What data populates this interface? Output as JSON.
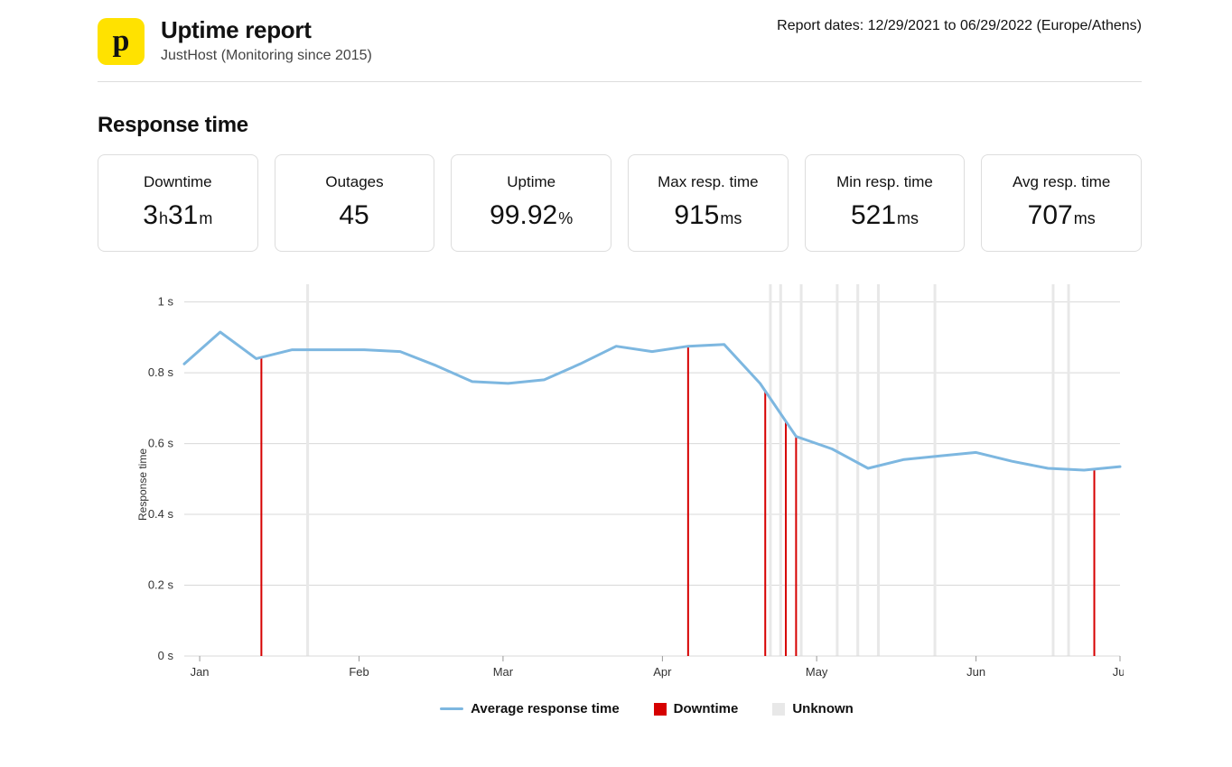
{
  "header": {
    "logo_char": "p",
    "title": "Uptime report",
    "subtitle": "JustHost (Monitoring since 2015)",
    "report_dates": "Report dates: 12/29/2021 to 06/29/2022 (Europe/Athens)"
  },
  "section_title": "Response time",
  "stats": {
    "downtime": {
      "label": "Downtime",
      "value_h": "3",
      "value_m": "31",
      "unit_h": "h",
      "unit_m": "m"
    },
    "outages": {
      "label": "Outages",
      "value": "45",
      "unit": ""
    },
    "uptime": {
      "label": "Uptime",
      "value": "99.92",
      "unit": "%"
    },
    "max": {
      "label": "Max resp. time",
      "value": "915",
      "unit": "ms"
    },
    "min": {
      "label": "Min resp. time",
      "value": "521",
      "unit": "ms"
    },
    "avg": {
      "label": "Avg resp. time",
      "value": "707",
      "unit": "ms"
    }
  },
  "legend": {
    "avg": "Average response time",
    "downtime": "Downtime",
    "unknown": "Unknown"
  },
  "chart_data": {
    "type": "line",
    "title": "",
    "xlabel": "",
    "ylabel": "Response time",
    "ylim": [
      0,
      1.05
    ],
    "y_ticks": [
      0,
      0.2,
      0.4,
      0.6,
      0.8,
      1.0
    ],
    "y_tick_labels": [
      "0 s",
      "0.2 s",
      "0.4 s",
      "0.6 s",
      "0.8 s",
      "1 s"
    ],
    "x_range_days": [
      0,
      182
    ],
    "x_month_ticks": [
      {
        "day": 3,
        "label": "Jan"
      },
      {
        "day": 34,
        "label": "Feb"
      },
      {
        "day": 62,
        "label": "Mar"
      },
      {
        "day": 93,
        "label": "Apr"
      },
      {
        "day": 123,
        "label": "May"
      },
      {
        "day": 154,
        "label": "Jun"
      },
      {
        "day": 182,
        "label": "Jul"
      }
    ],
    "series": [
      {
        "name": "Average response time",
        "color": "#7db7e0",
        "points": [
          {
            "day": 0,
            "value": 0.825
          },
          {
            "day": 7,
            "value": 0.915
          },
          {
            "day": 14,
            "value": 0.84
          },
          {
            "day": 21,
            "value": 0.865
          },
          {
            "day": 28,
            "value": 0.865
          },
          {
            "day": 35,
            "value": 0.865
          },
          {
            "day": 42,
            "value": 0.86
          },
          {
            "day": 49,
            "value": 0.82
          },
          {
            "day": 56,
            "value": 0.775
          },
          {
            "day": 63,
            "value": 0.77
          },
          {
            "day": 70,
            "value": 0.78
          },
          {
            "day": 77,
            "value": 0.825
          },
          {
            "day": 84,
            "value": 0.875
          },
          {
            "day": 91,
            "value": 0.86
          },
          {
            "day": 98,
            "value": 0.875
          },
          {
            "day": 105,
            "value": 0.88
          },
          {
            "day": 112,
            "value": 0.77
          },
          {
            "day": 119,
            "value": 0.62
          },
          {
            "day": 126,
            "value": 0.585
          },
          {
            "day": 133,
            "value": 0.53
          },
          {
            "day": 140,
            "value": 0.555
          },
          {
            "day": 147,
            "value": 0.565
          },
          {
            "day": 154,
            "value": 0.575
          },
          {
            "day": 161,
            "value": 0.55
          },
          {
            "day": 168,
            "value": 0.53
          },
          {
            "day": 175,
            "value": 0.525
          },
          {
            "day": 182,
            "value": 0.535
          }
        ]
      }
    ],
    "downtime_markers_days": [
      15,
      98,
      113,
      117,
      119,
      177
    ],
    "unknown_markers_days": [
      24,
      114,
      116,
      120,
      127,
      131,
      135,
      146,
      169,
      172
    ]
  },
  "colors": {
    "line": "#7db7e0",
    "downtime": "#d60000",
    "unknown": "#e8e8e8",
    "grid": "#d8d8d8",
    "axis": "#333"
  }
}
